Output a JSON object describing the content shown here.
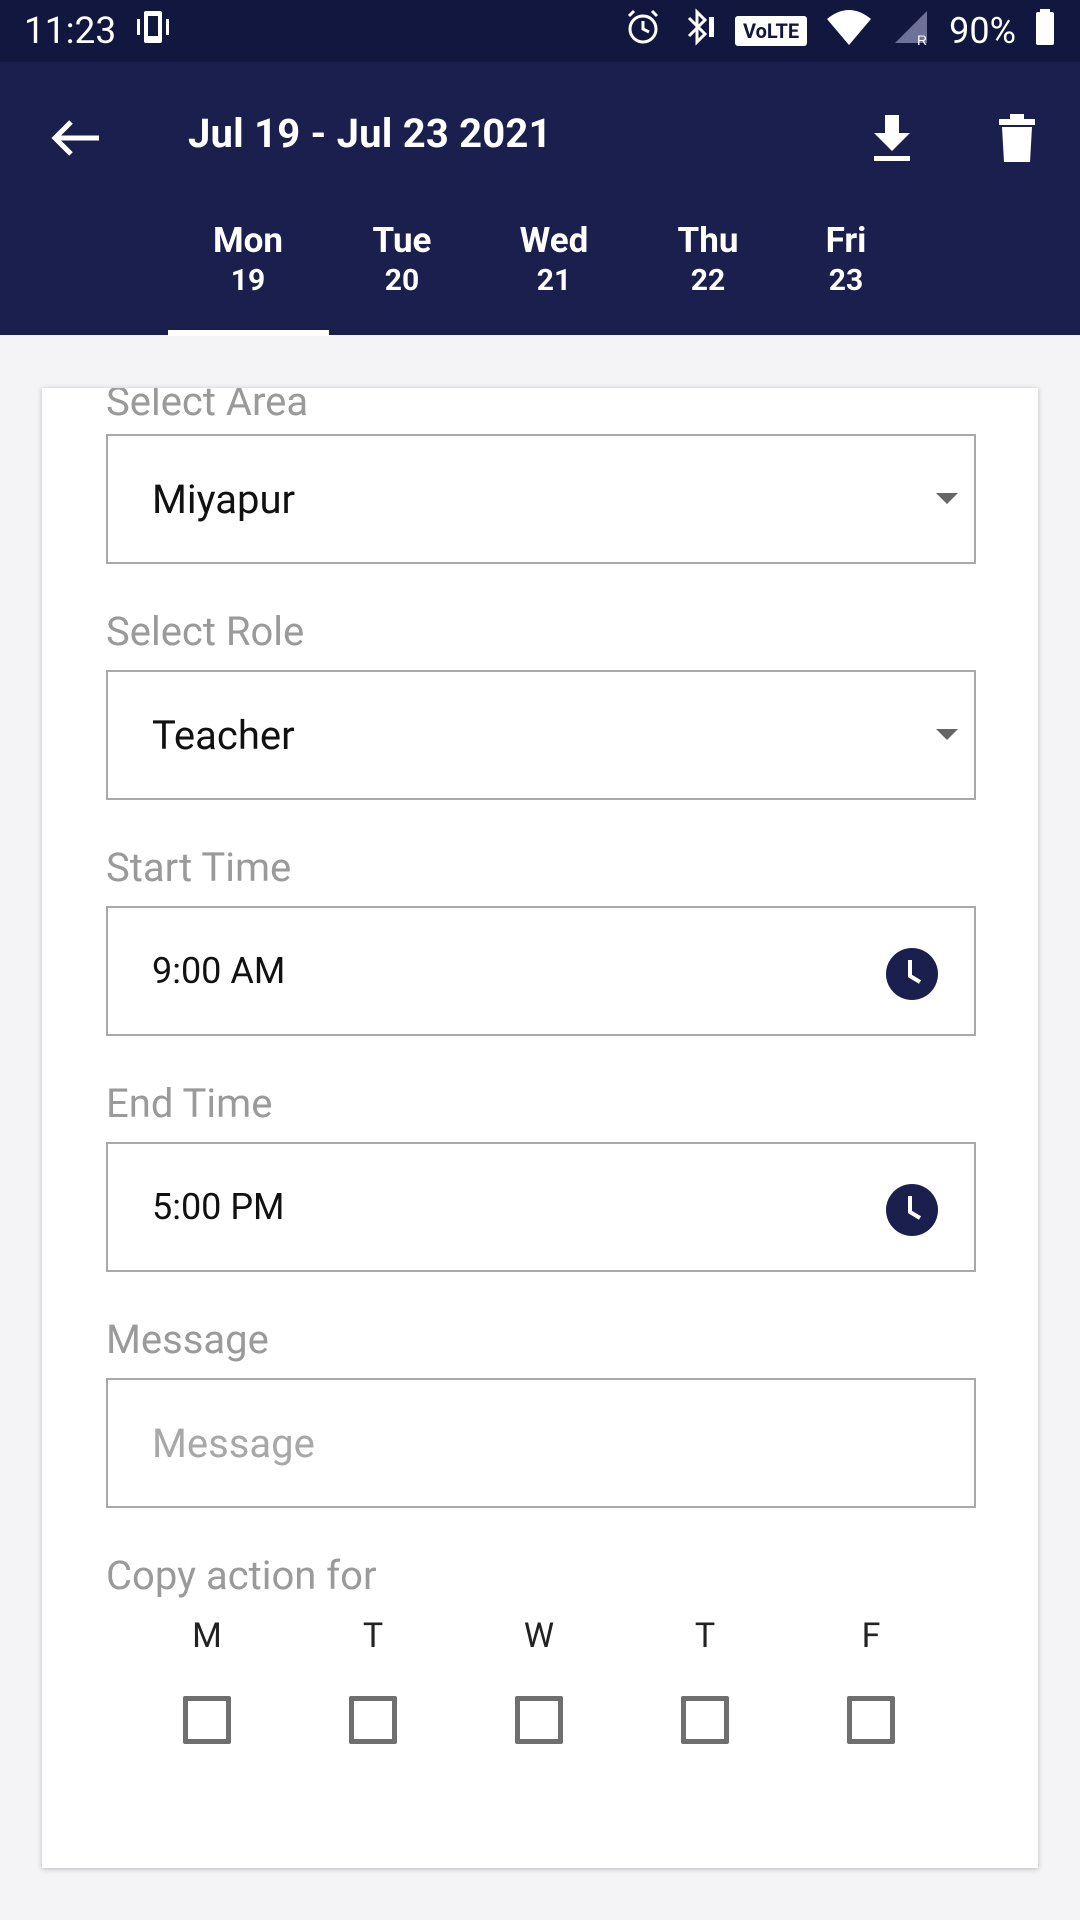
{
  "status_bar": {
    "time": "11:23",
    "volte": "VoLTE",
    "signal_roaming": "R",
    "battery": "90%"
  },
  "header": {
    "title": "Jul 19 - Jul 23 2021",
    "tabs": [
      {
        "day": "Mon",
        "num": "19"
      },
      {
        "day": "Tue",
        "num": "20"
      },
      {
        "day": "Wed",
        "num": "21"
      },
      {
        "day": "Thu",
        "num": "22"
      },
      {
        "day": "Fri",
        "num": "23"
      }
    ],
    "active_tab": "Mon"
  },
  "form": {
    "area": {
      "label": "Select Area",
      "value": "Miyapur"
    },
    "role": {
      "label": "Select Role",
      "value": "Teacher"
    },
    "start_time": {
      "label": "Start Time",
      "value": "9:00 AM"
    },
    "end_time": {
      "label": "End Time",
      "value": "5:00 PM"
    },
    "message": {
      "label": "Message",
      "placeholder": "Message"
    },
    "copy_action": {
      "label": "Copy action for",
      "days": [
        "M",
        "T",
        "W",
        "T",
        "F"
      ]
    }
  },
  "colors": {
    "app_bar": "#1a1f4d",
    "status_bar": "#12173f",
    "accent": "#1a1f4d"
  },
  "icons": {
    "back": "arrow-left-icon",
    "download": "download-icon",
    "delete": "trash-icon",
    "clock": "clock-icon"
  }
}
